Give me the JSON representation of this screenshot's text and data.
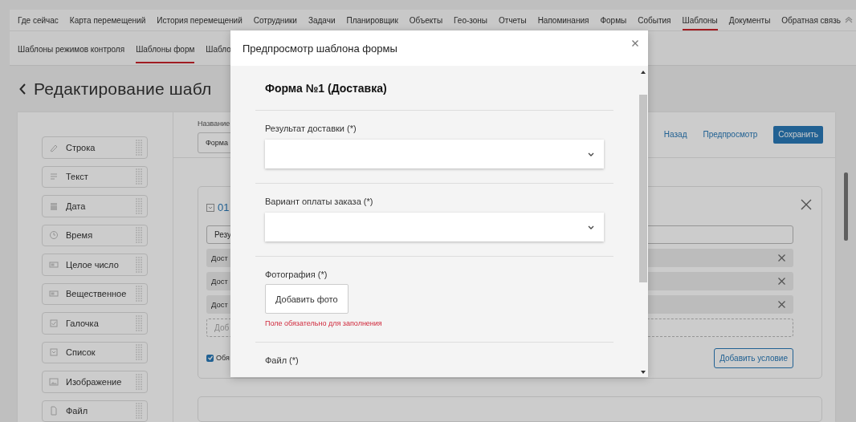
{
  "top_nav": {
    "items": [
      {
        "label": "Где сейчас",
        "selected": false
      },
      {
        "label": "Карта перемещений",
        "selected": false
      },
      {
        "label": "История перемещений",
        "selected": false
      },
      {
        "label": "Сотрудники",
        "selected": false
      },
      {
        "label": "Задачи",
        "selected": false
      },
      {
        "label": "Планировщик",
        "selected": false
      },
      {
        "label": "Объекты",
        "selected": false
      },
      {
        "label": "Гео-зоны",
        "selected": false
      },
      {
        "label": "Отчеты",
        "selected": false
      },
      {
        "label": "Напоминания",
        "selected": false
      },
      {
        "label": "Формы",
        "selected": false
      },
      {
        "label": "События",
        "selected": false
      },
      {
        "label": "Шаблоны",
        "selected": true
      },
      {
        "label": "Документы",
        "selected": false
      },
      {
        "label": "Обратная связь",
        "selected": false
      }
    ]
  },
  "sub_nav": {
    "items": [
      {
        "label": "Шаблоны режимов контроля",
        "selected": false
      },
      {
        "label": "Шаблоны форм",
        "selected": true
      },
      {
        "label": "Шабло",
        "selected": false
      }
    ]
  },
  "page_title": "Редактирование шабл",
  "palette": {
    "items": [
      {
        "label": "Строка",
        "kind": "string"
      },
      {
        "label": "Текст",
        "kind": "text"
      },
      {
        "label": "Дата",
        "kind": "date"
      },
      {
        "label": "Время",
        "kind": "time"
      },
      {
        "label": "Целое число",
        "kind": "integer"
      },
      {
        "label": "Вещественное",
        "kind": "real"
      },
      {
        "label": "Галочка",
        "kind": "checkbox"
      },
      {
        "label": "Список",
        "kind": "list"
      },
      {
        "label": "Изображение",
        "kind": "image"
      },
      {
        "label": "Файл",
        "kind": "file"
      }
    ]
  },
  "editor": {
    "name_label": "Название",
    "name_value": "Форма",
    "actions": [
      {
        "label": "Назад",
        "kind": "link"
      },
      {
        "label": "Предпросмотр",
        "kind": "link"
      },
      {
        "label": "Сохранить",
        "kind": "primary"
      }
    ],
    "condition_card": {
      "number": "01",
      "field_value": "Резу",
      "rows": [
        "Дост",
        "Дост",
        "Дост"
      ],
      "add_placeholder": "Доб",
      "required": {
        "label": "Обя",
        "checked": true
      },
      "add_button": "Добавить условие"
    }
  },
  "modal": {
    "title": "Предпросмотр шаблона формы",
    "form_title": "Форма №1 (Доставка)",
    "fields": [
      {
        "label": "Результат доставки (*)",
        "kind": "select"
      },
      {
        "label": "Вариант оплаты заказа (*)",
        "kind": "select"
      },
      {
        "label": "Фотография (*)",
        "kind": "photo",
        "button": "Добавить фото",
        "error": "Поле обязательно для заполнения"
      },
      {
        "label": "Файл (*)",
        "kind": "file"
      }
    ]
  }
}
